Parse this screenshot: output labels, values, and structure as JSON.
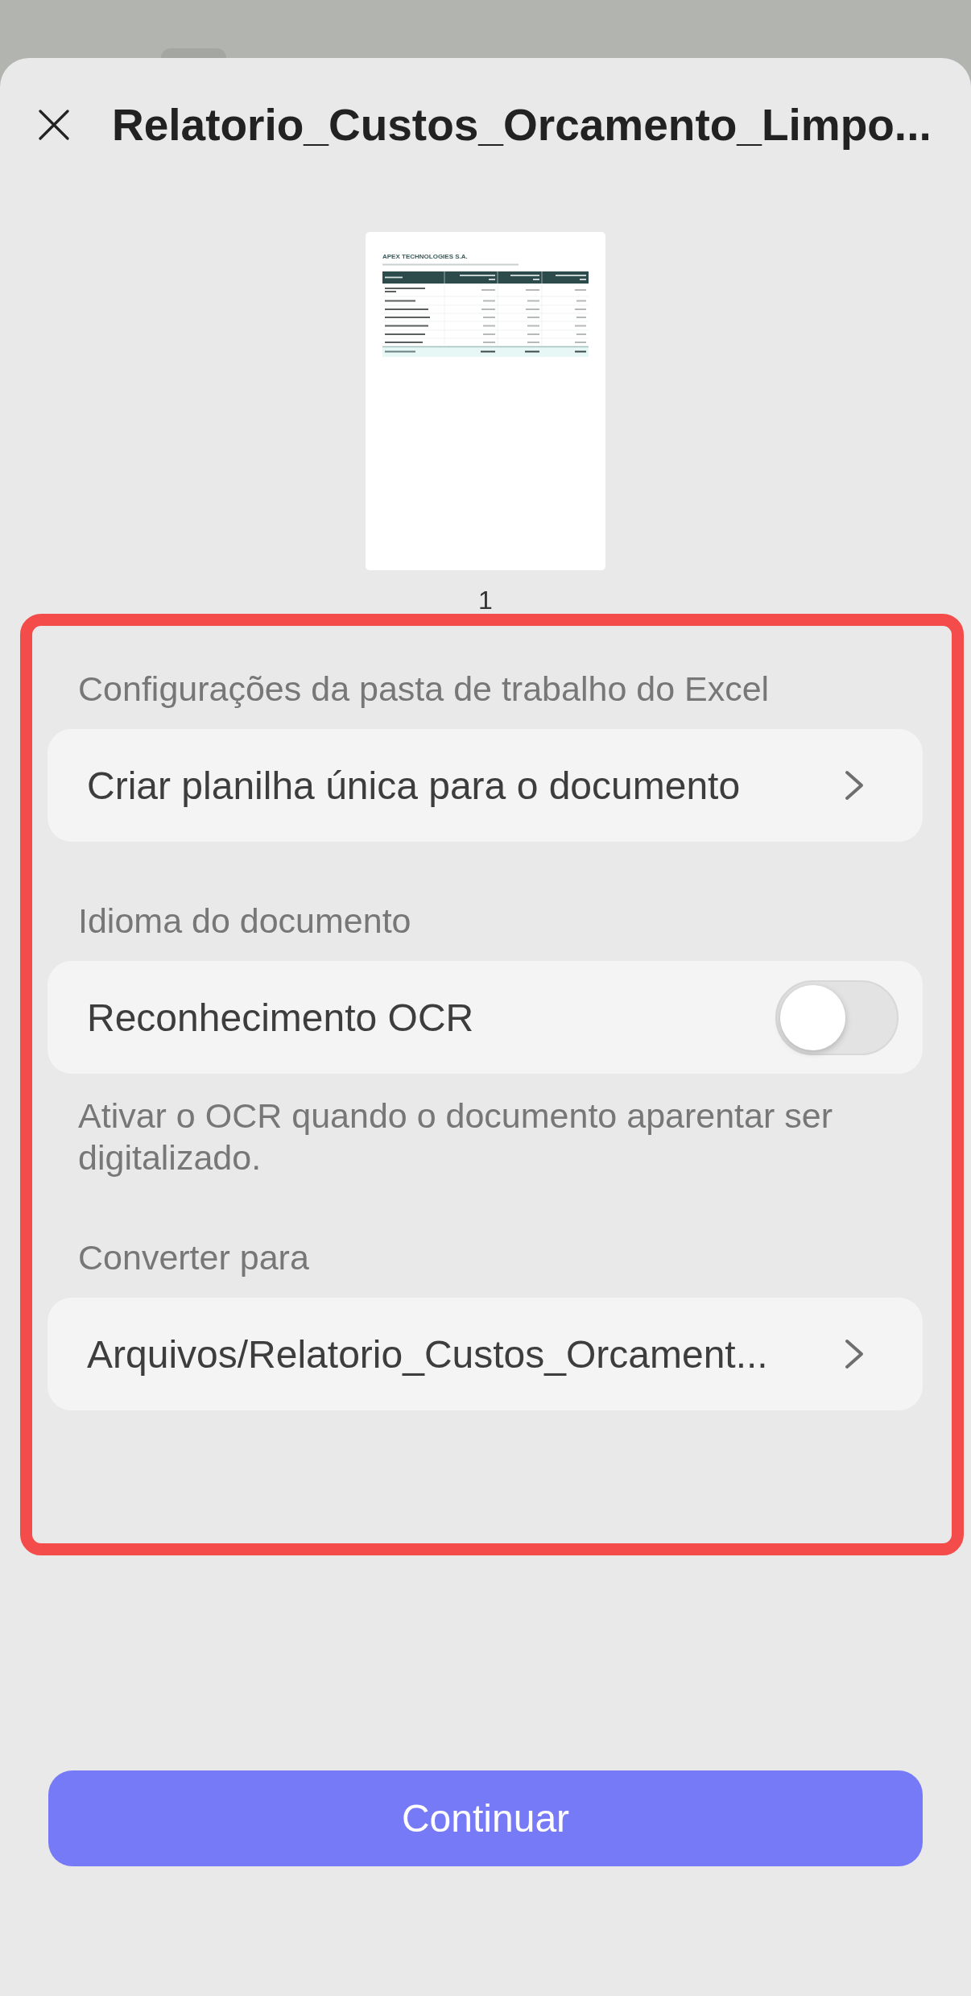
{
  "header": {
    "title": "Relatorio_Custos_Orcamento_Limpo..."
  },
  "preview": {
    "company": "APEX TECHNOLOGIES S.A.",
    "page_number": "1"
  },
  "sections": [
    {
      "label": "Configurações da pasta de trabalho do Excel",
      "row": {
        "kind": "link",
        "label": "Criar planilha única para o documento"
      }
    },
    {
      "label": "Idioma do documento",
      "row": {
        "kind": "toggle",
        "label": "Reconhecimento OCR",
        "on": false
      },
      "note": "Ativar o OCR quando o documento aparentar ser digitalizado."
    },
    {
      "label": "Converter para",
      "row": {
        "kind": "link",
        "label": "Arquivos/Relatorio_Custos_Orcament..."
      }
    }
  ],
  "primary_button": {
    "label": "Continuar"
  }
}
